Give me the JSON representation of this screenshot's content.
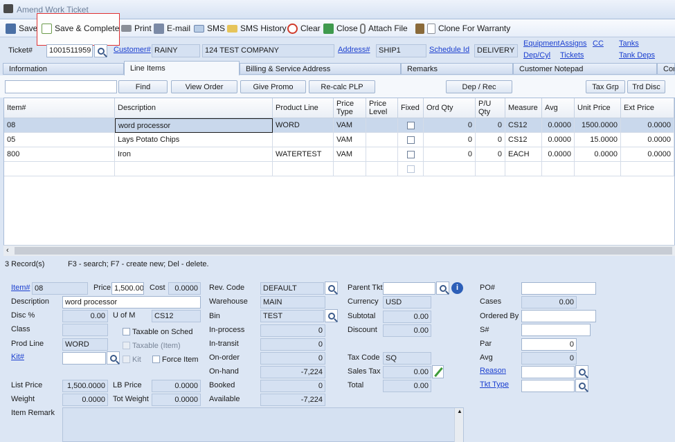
{
  "window": {
    "title": "Amend Work Ticket"
  },
  "toolbar": {
    "save": "Save",
    "save_complete": "Save & Complete",
    "print": "Print",
    "email": "E-mail",
    "sms": "SMS",
    "sms_history": "SMS History",
    "clear": "Clear",
    "close": "Close",
    "attach": "Attach File",
    "clone": "Clone For Warranty"
  },
  "header": {
    "ticket_label": "Ticket#",
    "ticket": "1001511959",
    "customer_label": "Customer#",
    "customer": "RAINY",
    "company": "124 TEST COMPANY",
    "address_label": "Address#",
    "address": "SHIP1",
    "schedule_label": "Schedule Id",
    "schedule": "DELIVERY",
    "equipment": "Equipment",
    "assigns": "Assigns",
    "cc": "CC",
    "tanks": "Tanks",
    "depcyl": "Dep/Cyl",
    "tickets": "Tickets",
    "tankdeps": "Tank Deps"
  },
  "tabs": [
    "Information",
    "Line Items",
    "Billing & Service Address",
    "Remarks",
    "Customer Notepad",
    "Com"
  ],
  "actions": {
    "find": "Find",
    "view_order": "View Order",
    "give_promo": "Give Promo",
    "recalc": "Re-calc PLP",
    "deprec": "Dep / Rec",
    "taxgrp": "Tax Grp",
    "trddisc": "Trd Disc"
  },
  "grid": {
    "columns": [
      "Item#",
      "Description",
      "Product Line",
      "Price Type",
      "Price Level",
      "Fixed",
      "Ord Qty",
      "P/U Qty",
      "Measure",
      "Avg",
      "Unit Price",
      "Ext Price"
    ],
    "rows": [
      [
        "08",
        "word processor",
        "WORD",
        "VAM",
        "",
        "",
        "0",
        "0",
        "CS12",
        "0.0000",
        "1500.0000",
        "0.0000"
      ],
      [
        "05",
        "Lays Potato Chips",
        "",
        "VAM",
        "",
        "",
        "0",
        "0",
        "CS12",
        "0.0000",
        "15.0000",
        "0.0000"
      ],
      [
        "800",
        "Iron",
        "WATERTEST",
        "VAM",
        "",
        "",
        "0",
        "0",
        "EACH",
        "0.0000",
        "0.0000",
        "0.0000"
      ]
    ]
  },
  "status": {
    "records": "3 Record(s)",
    "hint": "F3 - search; F7 - create new; Del - delete."
  },
  "detail": {
    "item_label": "Item#",
    "item": "08",
    "price_label": "Price",
    "price": "1,500.00",
    "cost_label": "Cost",
    "cost": "0.0000",
    "desc_label": "Description",
    "desc": "word processor",
    "disc_label": "Disc %",
    "disc": "0.00",
    "uom_label": "U of M",
    "uom": "CS12",
    "class_label": "Class",
    "taxable_sched": "Taxable on Sched",
    "prodline_label": "Prod Line",
    "prodline": "WORD",
    "taxable_item": "Taxable (Item)",
    "kit_label": "Kit#",
    "kit_chk": "Kit",
    "force_item": "Force Item",
    "listprice_label": "List Price",
    "listprice": "1,500.0000",
    "lbprice_label": "LB Price",
    "lbprice": "0.0000",
    "weight_label": "Weight",
    "weight": "0.0000",
    "totweight_label": "Tot Weight",
    "totweight": "0.0000",
    "remark_label": "Item Remark",
    "revcode_label": "Rev. Code",
    "revcode": "DEFAULT",
    "warehouse_label": "Warehouse",
    "warehouse": "MAIN",
    "bin_label": "Bin",
    "bin": "TEST",
    "inprocess_label": "In-process",
    "inprocess": "0",
    "intransit_label": "In-transit",
    "intransit": "0",
    "onorder_label": "On-order",
    "onorder": "0",
    "onhand_label": "On-hand",
    "onhand": "-7,224",
    "booked_label": "Booked",
    "booked": "0",
    "available_label": "Available",
    "available": "-7,224",
    "parent_label": "Parent Tkt",
    "currency_label": "Currency",
    "currency": "USD",
    "subtotal_label": "Subtotal",
    "subtotal": "0.00",
    "discount_label": "Discount",
    "discount": "0.00",
    "taxcode_label": "Tax Code",
    "taxcode": "SQ",
    "salestax_label": "Sales Tax",
    "salestax": "0.00",
    "total_label": "Total",
    "total": "0.00",
    "po_label": "PO#",
    "cases_label": "Cases",
    "cases": "0.00",
    "orderedby_label": "Ordered By",
    "s_label": "S#",
    "par_label": "Par",
    "par": "0",
    "avg_label": "Avg",
    "avg": "0",
    "reason_label": "Reason",
    "tkttype_label": "Tkt Type"
  },
  "colors": {
    "accent": "#1a3ecf",
    "highlight_border": "#e03030",
    "selected_row": "#c9d8ec",
    "panel": "#dce6f4"
  }
}
